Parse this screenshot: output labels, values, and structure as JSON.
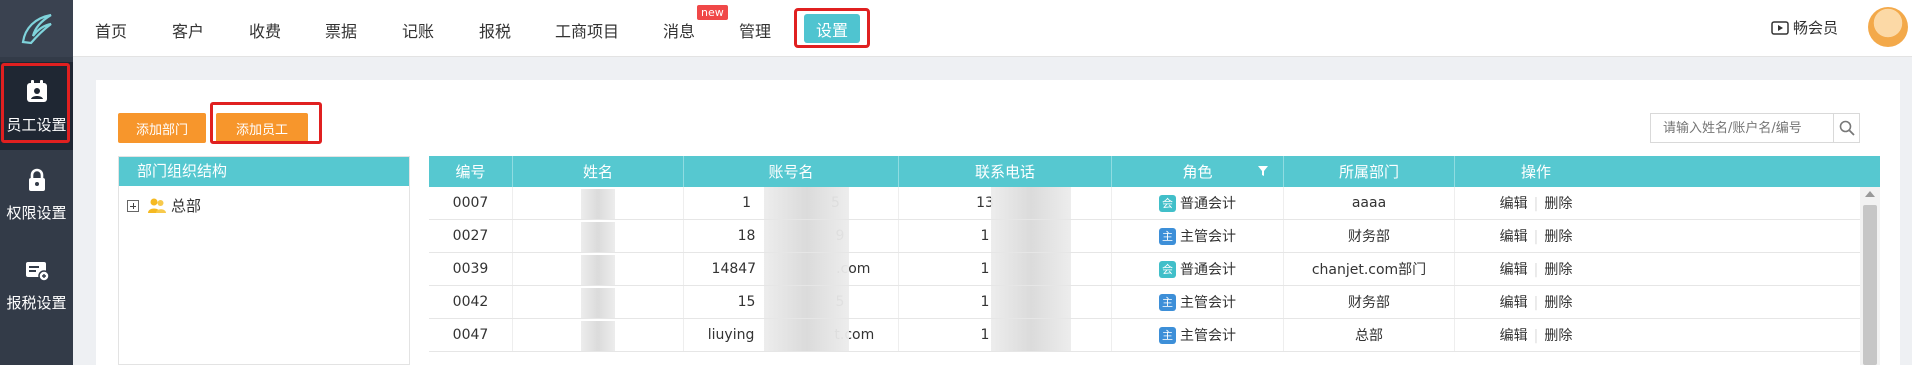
{
  "sidebar": {
    "items": [
      {
        "label": "员工设置",
        "icon": "badge-icon"
      },
      {
        "label": "权限设置",
        "icon": "lock-icon"
      },
      {
        "label": "报税设置",
        "icon": "tax-icon"
      }
    ]
  },
  "topnav": {
    "items": [
      "首页",
      "客户",
      "收费",
      "票据",
      "记账",
      "报税",
      "工商项目",
      "消息",
      "管理"
    ],
    "active": "设置",
    "badge": "new",
    "member_label": "畅会员"
  },
  "toolbar": {
    "add_dept": "添加部门",
    "add_staff": "添加员工",
    "search_placeholder": "请输入姓名/账户名/编号"
  },
  "tree": {
    "header": "部门组织结构",
    "root": "总部"
  },
  "table": {
    "columns": [
      "编号",
      "姓名",
      "账号名",
      "联系电话",
      "角色",
      "所属部门",
      "操作"
    ],
    "rows": [
      {
        "id": "0007",
        "name": "",
        "account": "1",
        "account_tail": "5",
        "phone": "13",
        "role_tag": "会",
        "role": "普通会计",
        "dept": "aaaa"
      },
      {
        "id": "0027",
        "name": "",
        "account": "18",
        "account_tail": "9",
        "phone": "1",
        "role_tag": "主",
        "role": "主管会计",
        "dept": "财务部"
      },
      {
        "id": "0039",
        "name": "",
        "account": "14847",
        "account_tail": ".com",
        "phone": "1",
        "role_tag": "会",
        "role": "普通会计",
        "dept": "chanjet.com部门"
      },
      {
        "id": "0042",
        "name": "",
        "account": "15",
        "account_tail": "5",
        "phone": "1",
        "role_tag": "主",
        "role": "主管会计",
        "dept": "财务部"
      },
      {
        "id": "0047",
        "name": "",
        "account": "liuying",
        "account_tail": "t.com",
        "phone": "1",
        "role_tag": "主",
        "role": "主管会计",
        "dept": "总部"
      }
    ],
    "edit": "编辑",
    "delete": "删除"
  },
  "colors": {
    "accent": "#56c8d0",
    "orange": "#f7962c",
    "sidebar": "#333b48",
    "highlight": "#e02020"
  }
}
